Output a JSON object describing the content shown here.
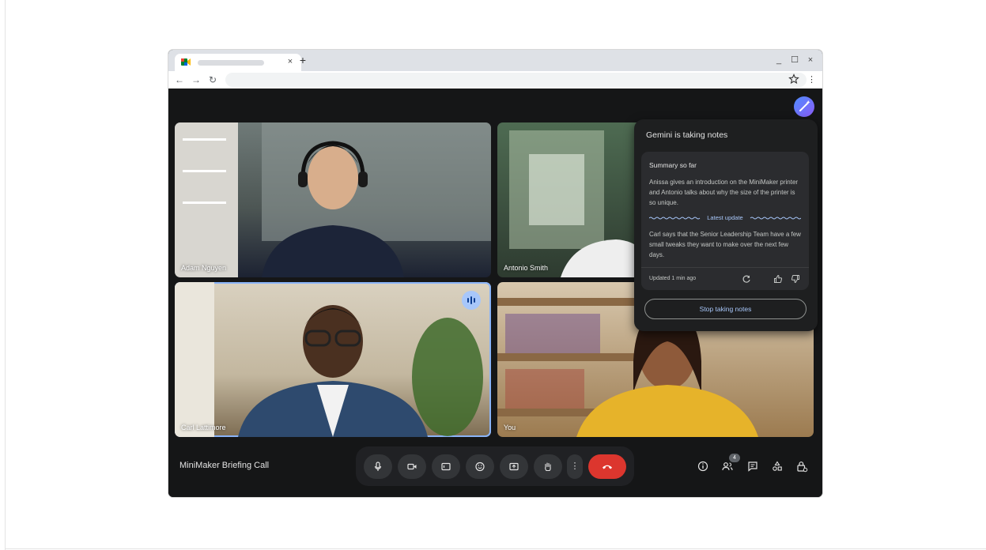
{
  "browser": {
    "tab": {
      "favicon": "google-meet-icon",
      "close_icon": "close-icon",
      "close_label": "×"
    },
    "new_tab_label": "+",
    "window_controls": {
      "minimize": "_",
      "maximize": "☐",
      "close": "×"
    },
    "nav": {
      "back": "←",
      "forward": "→",
      "reload": "↻"
    },
    "bookmark_icon": "star-icon",
    "menu_label": "⋮"
  },
  "tiles": [
    {
      "name": "Adam Nguyen",
      "colors": [
        "#5e6b6e",
        "#1c2232"
      ]
    },
    {
      "name": "Antonio Smith",
      "colors": [
        "#4a6a4c",
        "#2a3a2d"
      ]
    },
    {
      "name": "Carl Lattimore",
      "colors": [
        "#c9bea8",
        "#2e4a6e"
      ],
      "speaking": true
    },
    {
      "name": "You",
      "colors": [
        "#c49a5c",
        "#e6b32a"
      ]
    }
  ],
  "gemini_panel": {
    "title": "Gemini is taking notes",
    "summary_heading": "Summary so far",
    "summary_text": "Anissa gives an introduction on the MiniMaker printer and Antonio talks about why the size of the printer is so unique.",
    "update_label": "Latest update",
    "update_text": "Carl says that the Senior Leadership Team have a few small tweaks they want to make over the next few days.",
    "updated_status": "Updated 1 min ago",
    "stop_button_label": "Stop taking notes"
  },
  "meeting": {
    "title": "MiniMaker Briefing Call",
    "participant_count": "4",
    "more_label": "⋮"
  },
  "colors": {
    "accent": "#a8c7fa",
    "end_call": "#dc362e",
    "meet_background": "#151617",
    "speaking_border": "#8ab4f8"
  }
}
